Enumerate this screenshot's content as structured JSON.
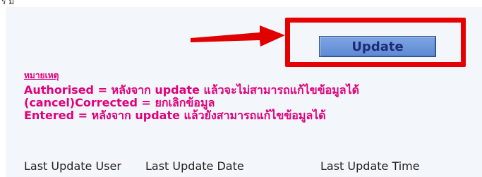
{
  "top_fragment": "ร ม",
  "update_button": {
    "label": "Update"
  },
  "note": {
    "heading": "หมายเหตุ",
    "lines": [
      "Authorised = หลังจาก update แล้วจะไม่สามารถแก้ไขข้อมูลได้",
      "(cancel)Corrected = ยกเลิกข้อมูล",
      "Entered = หลังจาก update แล้วยังสามารถแก้ไขข้อมูลได้"
    ]
  },
  "footer": {
    "last_update_user": "Last Update User",
    "last_update_date": "Last Update Date",
    "last_update_time": "Last Update Time"
  },
  "colors": {
    "highlight_border": "#e60000",
    "note_text": "#e0007a",
    "button_fill": "#6f9ad9"
  }
}
